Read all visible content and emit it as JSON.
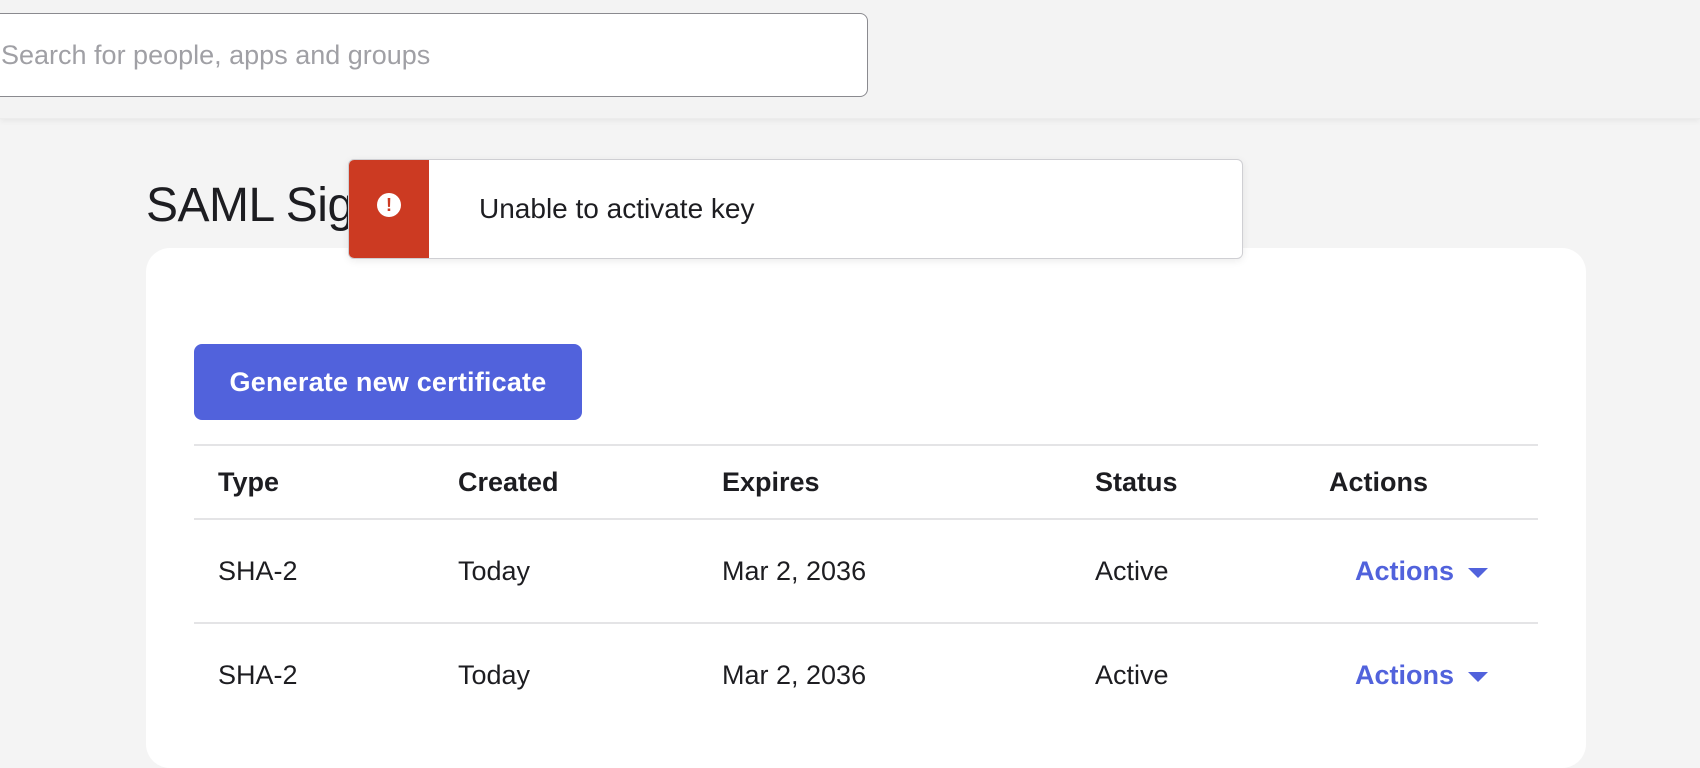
{
  "search": {
    "placeholder": "Search for people, apps and groups"
  },
  "page": {
    "title": "SAML Signing Certificates"
  },
  "toolbar": {
    "generate_label": "Generate new certificate"
  },
  "table": {
    "columns": [
      "Type",
      "Created",
      "Expires",
      "Status",
      "Actions"
    ],
    "rows": [
      {
        "type": "SHA-2",
        "created": "Today",
        "expires": "Mar 2, 2036",
        "status": "Active",
        "action": "Actions"
      },
      {
        "type": "SHA-2",
        "created": "Today",
        "expires": "Mar 2, 2036",
        "status": "Active",
        "action": "Actions"
      }
    ]
  },
  "toast": {
    "message": "Unable to activate key",
    "icon": "alert-circle-icon",
    "accent": "#cc3a22"
  },
  "colors": {
    "primary": "#5162dc",
    "error": "#cc3a22"
  }
}
